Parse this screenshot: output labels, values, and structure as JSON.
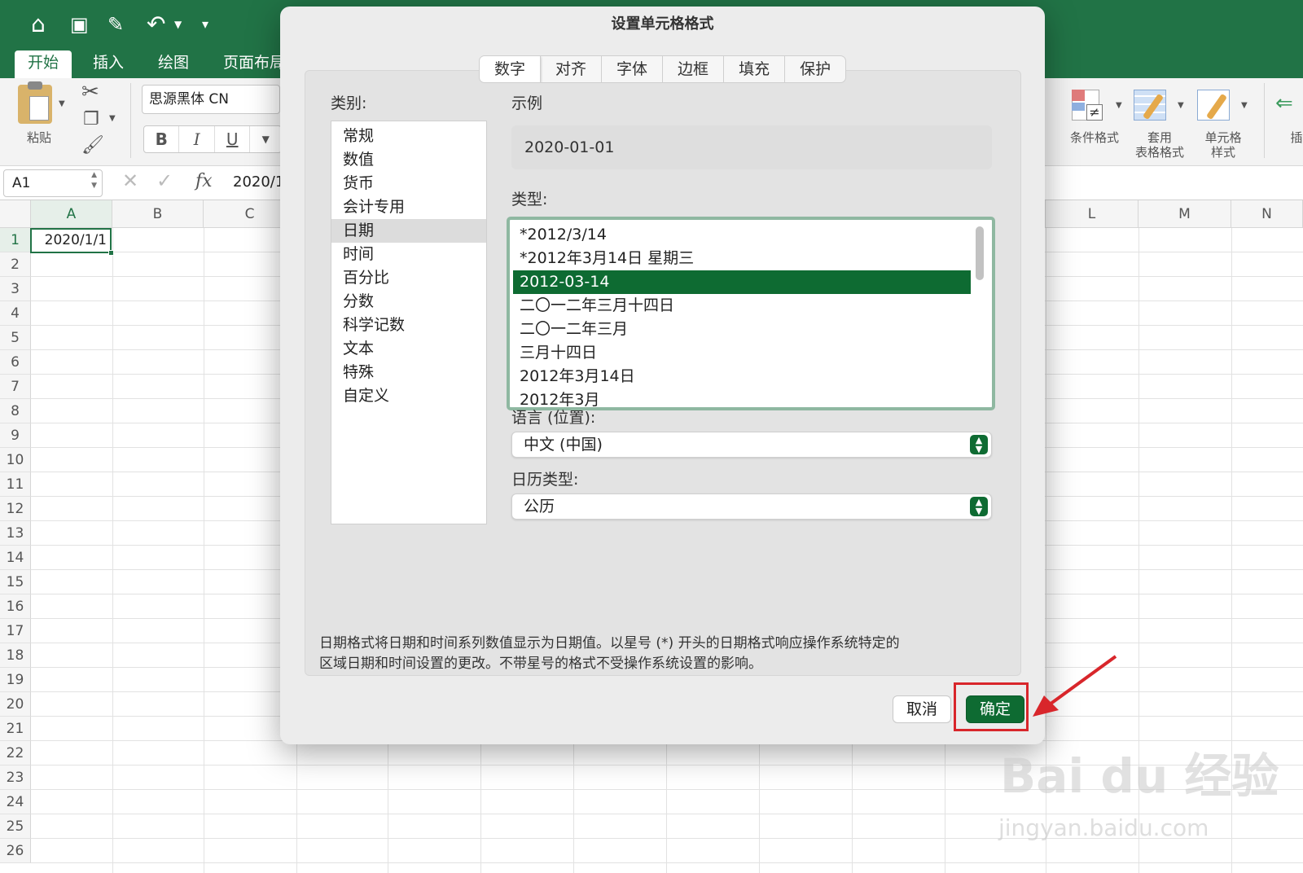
{
  "ribbon_tabs": [
    "开始",
    "插入",
    "绘图",
    "页面布局"
  ],
  "ribbon": {
    "paste_label": "粘贴",
    "font_name": "思源黑体 CN",
    "bold": "B",
    "italic": "I",
    "underline": "U",
    "conditional_format": "条件格式",
    "table_format_1": "套用",
    "table_format_2": "表格格式",
    "cell_style_1": "单元格",
    "cell_style_2": "样式",
    "insert_partial": "插"
  },
  "formula_bar": {
    "name_box": "A1",
    "fx": "fx",
    "content": "2020/1"
  },
  "sheet": {
    "columns_left": [
      "A",
      "B",
      "C"
    ],
    "columns_right": [
      "L",
      "M",
      "N"
    ],
    "rows": [
      "1",
      "2",
      "3",
      "4",
      "5",
      "6",
      "7",
      "8",
      "9",
      "10",
      "11",
      "12",
      "13",
      "14",
      "15",
      "16",
      "17",
      "18",
      "19",
      "20",
      "21",
      "22",
      "23",
      "24",
      "25",
      "26"
    ],
    "cell_a1": "2020/1/1"
  },
  "dialog": {
    "title": "设置单元格格式",
    "tabs": [
      "数字",
      "对齐",
      "字体",
      "边框",
      "填充",
      "保护"
    ],
    "selected_tab": "数字",
    "category_label": "类别:",
    "categories": [
      "常规",
      "数值",
      "货币",
      "会计专用",
      "日期",
      "时间",
      "百分比",
      "分数",
      "科学记数",
      "文本",
      "特殊",
      "自定义"
    ],
    "selected_category": "日期",
    "sample_label": "示例",
    "sample_value": "2020-01-01",
    "type_label": "类型:",
    "types": [
      "*2012/3/14",
      "*2012年3月14日 星期三",
      "2012-03-14",
      "二〇一二年三月十四日",
      "二〇一二年三月",
      "三月十四日",
      "2012年3月14日",
      "2012年3月"
    ],
    "selected_type": "2012-03-14",
    "locale_label": "语言 (位置):",
    "locale_value": "中文 (中国)",
    "calendar_label": "日历类型:",
    "calendar_value": "公历",
    "description_line1": "日期格式将日期和时间系列数值显示为日期值。以星号 (*) 开头的日期格式响应操作系统特定的",
    "description_line2": "区域日期和时间设置的更改。不带星号的格式不受操作系统设置的影响。",
    "cancel_label": "取消",
    "ok_label": "确定"
  },
  "watermark": {
    "brand": "Bai du 经验",
    "url": "jingyan.baidu.com"
  },
  "colors": {
    "excel_green": "#217346",
    "accent": "#0e6b32",
    "annotation_red": "#d8262b"
  }
}
